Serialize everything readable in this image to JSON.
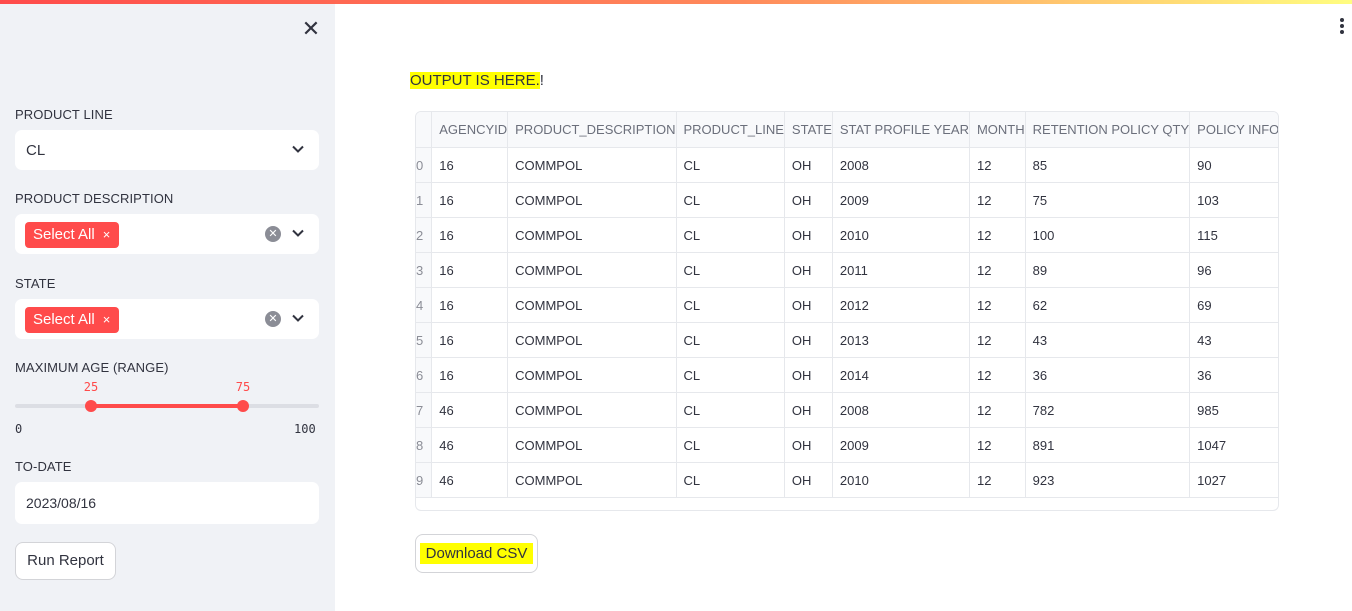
{
  "sidebar": {
    "close_icon": "close-icon",
    "product_line": {
      "label": "PRODUCT LINE",
      "value": "CL"
    },
    "product_description": {
      "label": "PRODUCT DESCRIPTION",
      "chip": "Select All",
      "chip_remove": "×"
    },
    "state": {
      "label": "STATE",
      "chip": "Select All",
      "chip_remove": "×"
    },
    "max_age": {
      "label": "MAXIMUM AGE (RANGE)",
      "low": "25",
      "high": "75",
      "min": "0",
      "max": "100"
    },
    "to_date": {
      "label": "TO-DATE",
      "value": "2023/08/16"
    },
    "run_button": "Run Report"
  },
  "main": {
    "output_text": "OUTPUT IS HERE.",
    "output_suffix": "!",
    "download_button": "Download CSV",
    "table": {
      "columns": [
        "",
        "AGENCYID",
        "PRODUCT_DESCRIPTION",
        "PRODUCT_LINE",
        "STATE",
        "STAT PROFILE YEAR",
        "MONTH",
        "RETENTION POLICY QTY",
        "POLICY INFORCE QTY"
      ],
      "rows": [
        [
          "0",
          "16",
          "COMMPOL",
          "CL",
          "OH",
          "2008",
          "12",
          "85",
          "90"
        ],
        [
          "1",
          "16",
          "COMMPOL",
          "CL",
          "OH",
          "2009",
          "12",
          "75",
          "103"
        ],
        [
          "2",
          "16",
          "COMMPOL",
          "CL",
          "OH",
          "2010",
          "12",
          "100",
          "115"
        ],
        [
          "3",
          "16",
          "COMMPOL",
          "CL",
          "OH",
          "2011",
          "12",
          "89",
          "96"
        ],
        [
          "4",
          "16",
          "COMMPOL",
          "CL",
          "OH",
          "2012",
          "12",
          "62",
          "69"
        ],
        [
          "5",
          "16",
          "COMMPOL",
          "CL",
          "OH",
          "2013",
          "12",
          "43",
          "43"
        ],
        [
          "6",
          "16",
          "COMMPOL",
          "CL",
          "OH",
          "2014",
          "12",
          "36",
          "36"
        ],
        [
          "7",
          "46",
          "COMMPOL",
          "CL",
          "OH",
          "2008",
          "12",
          "782",
          "985"
        ],
        [
          "8",
          "46",
          "COMMPOL",
          "CL",
          "OH",
          "2009",
          "12",
          "891",
          "1047"
        ],
        [
          "9",
          "46",
          "COMMPOL",
          "CL",
          "OH",
          "2010",
          "12",
          "923",
          "1027"
        ]
      ]
    }
  },
  "colors": {
    "accent": "#ff4b4b",
    "highlight": "#ffff00",
    "sidebar_bg": "#f0f2f6"
  }
}
